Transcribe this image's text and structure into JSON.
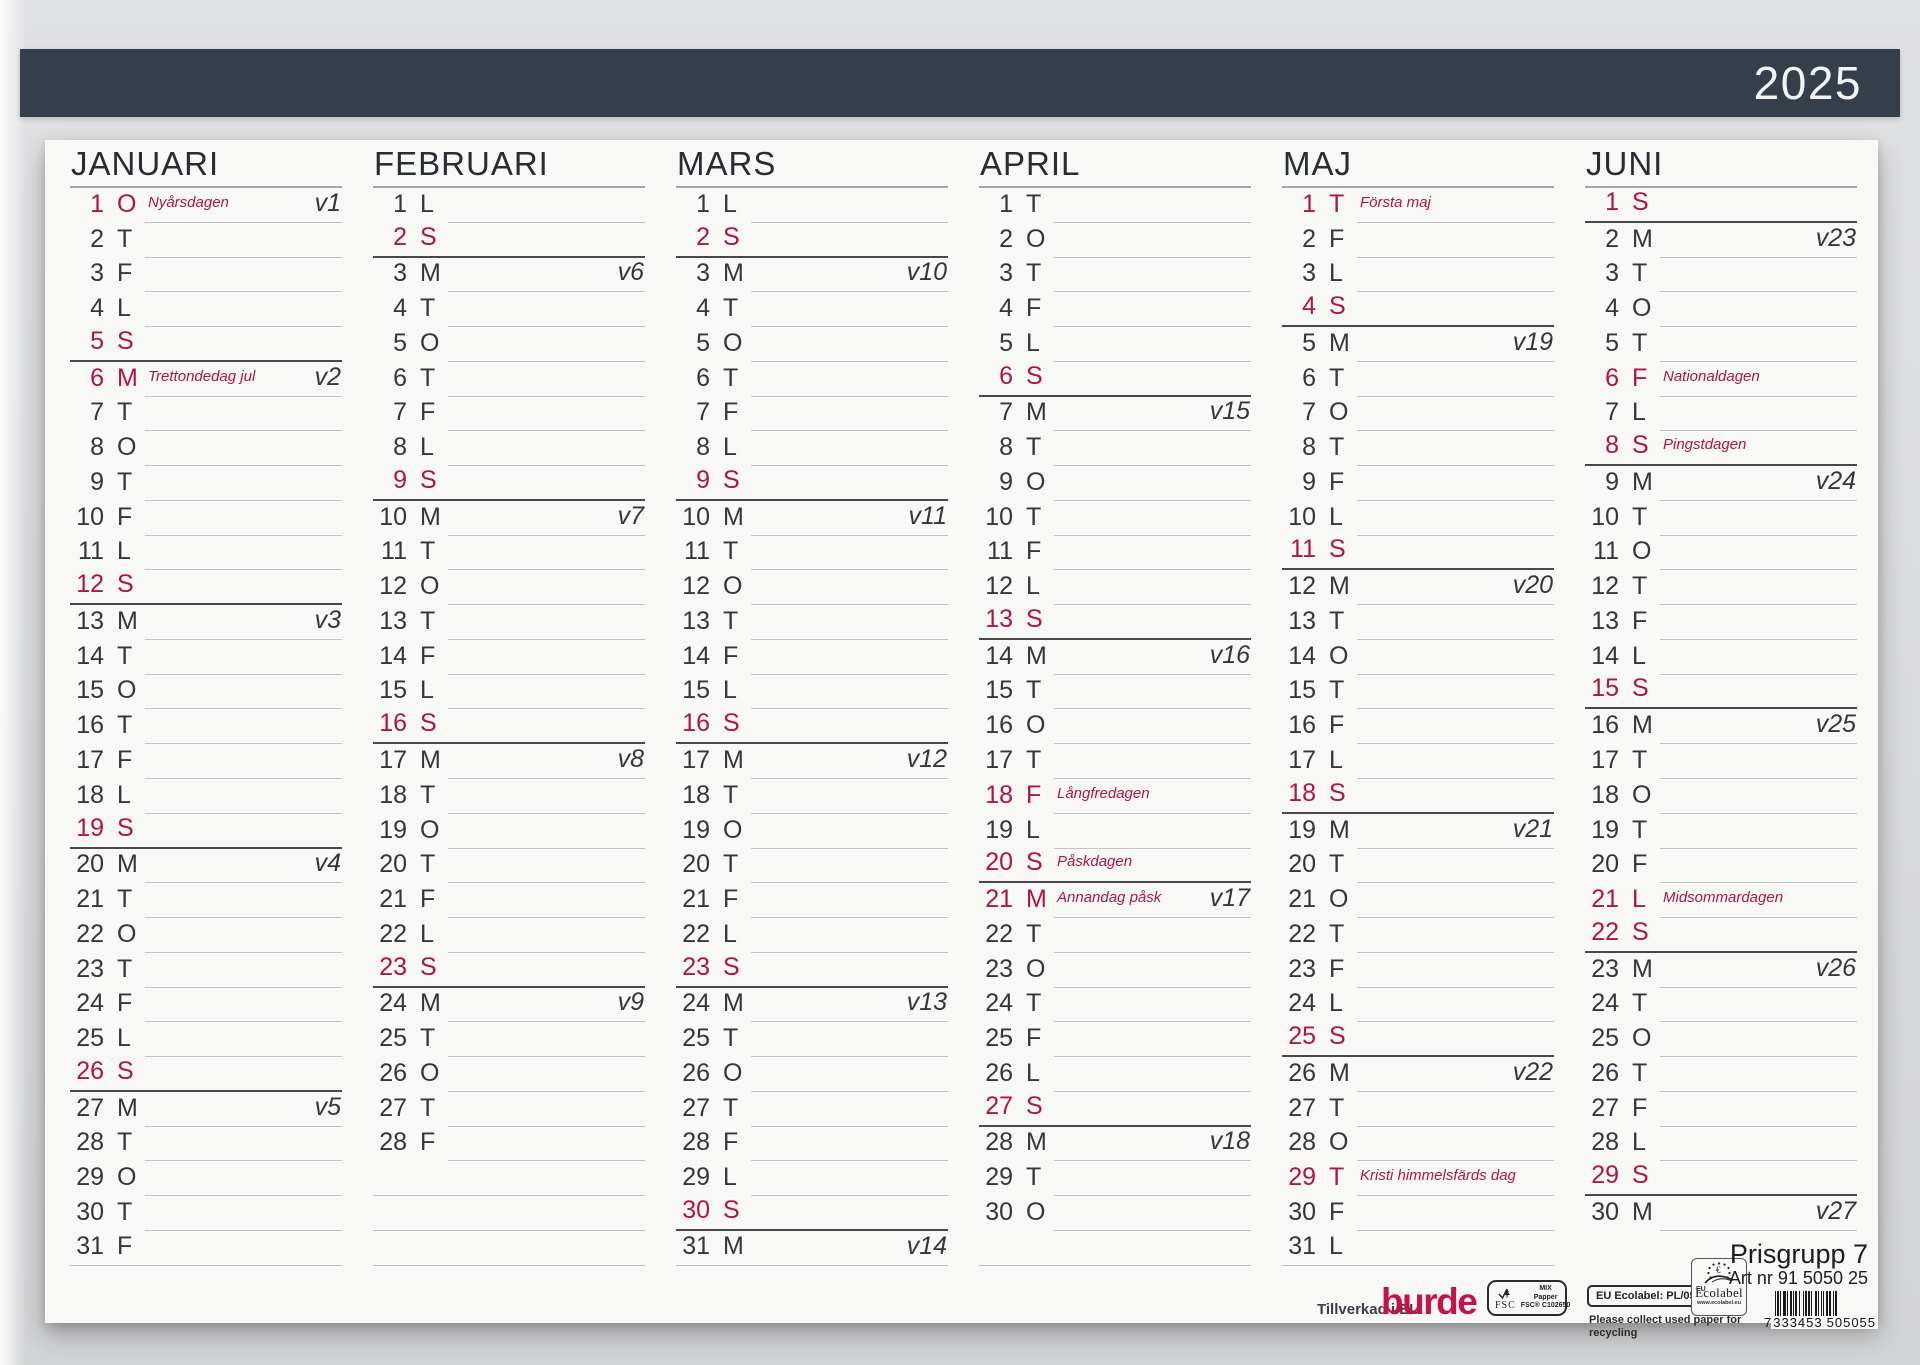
{
  "year": "2025",
  "colors": {
    "band": "#353e4b",
    "red": "#ae1543",
    "brand_red": "#c4134a",
    "paper": "#f8f8f7"
  },
  "months": [
    {
      "name": "JANUARI",
      "blanks": 0,
      "days": [
        {
          "d": 1,
          "w": "O",
          "r": true,
          "h": "Nyårsdagen",
          "v": "v1"
        },
        {
          "d": 2,
          "w": "T"
        },
        {
          "d": 3,
          "w": "F"
        },
        {
          "d": 4,
          "w": "L"
        },
        {
          "d": 5,
          "w": "S"
        },
        {
          "d": 6,
          "w": "M",
          "r": true,
          "h": "Trettondedag jul",
          "v": "v2"
        },
        {
          "d": 7,
          "w": "T"
        },
        {
          "d": 8,
          "w": "O"
        },
        {
          "d": 9,
          "w": "T"
        },
        {
          "d": 10,
          "w": "F"
        },
        {
          "d": 11,
          "w": "L"
        },
        {
          "d": 12,
          "w": "S"
        },
        {
          "d": 13,
          "w": "M",
          "v": "v3"
        },
        {
          "d": 14,
          "w": "T"
        },
        {
          "d": 15,
          "w": "O"
        },
        {
          "d": 16,
          "w": "T"
        },
        {
          "d": 17,
          "w": "F"
        },
        {
          "d": 18,
          "w": "L"
        },
        {
          "d": 19,
          "w": "S"
        },
        {
          "d": 20,
          "w": "M",
          "v": "v4"
        },
        {
          "d": 21,
          "w": "T"
        },
        {
          "d": 22,
          "w": "O"
        },
        {
          "d": 23,
          "w": "T"
        },
        {
          "d": 24,
          "w": "F"
        },
        {
          "d": 25,
          "w": "L"
        },
        {
          "d": 26,
          "w": "S"
        },
        {
          "d": 27,
          "w": "M",
          "v": "v5"
        },
        {
          "d": 28,
          "w": "T"
        },
        {
          "d": 29,
          "w": "O"
        },
        {
          "d": 30,
          "w": "T"
        },
        {
          "d": 31,
          "w": "F"
        }
      ]
    },
    {
      "name": "FEBRUARI",
      "blanks": 3,
      "days": [
        {
          "d": 1,
          "w": "L"
        },
        {
          "d": 2,
          "w": "S"
        },
        {
          "d": 3,
          "w": "M",
          "v": "v6"
        },
        {
          "d": 4,
          "w": "T"
        },
        {
          "d": 5,
          "w": "O"
        },
        {
          "d": 6,
          "w": "T"
        },
        {
          "d": 7,
          "w": "F"
        },
        {
          "d": 8,
          "w": "L"
        },
        {
          "d": 9,
          "w": "S"
        },
        {
          "d": 10,
          "w": "M",
          "v": "v7"
        },
        {
          "d": 11,
          "w": "T"
        },
        {
          "d": 12,
          "w": "O"
        },
        {
          "d": 13,
          "w": "T"
        },
        {
          "d": 14,
          "w": "F"
        },
        {
          "d": 15,
          "w": "L"
        },
        {
          "d": 16,
          "w": "S"
        },
        {
          "d": 17,
          "w": "M",
          "v": "v8"
        },
        {
          "d": 18,
          "w": "T"
        },
        {
          "d": 19,
          "w": "O"
        },
        {
          "d": 20,
          "w": "T"
        },
        {
          "d": 21,
          "w": "F"
        },
        {
          "d": 22,
          "w": "L"
        },
        {
          "d": 23,
          "w": "S"
        },
        {
          "d": 24,
          "w": "M",
          "v": "v9"
        },
        {
          "d": 25,
          "w": "T"
        },
        {
          "d": 26,
          "w": "O"
        },
        {
          "d": 27,
          "w": "T"
        },
        {
          "d": 28,
          "w": "F"
        }
      ]
    },
    {
      "name": "MARS",
      "blanks": 0,
      "days": [
        {
          "d": 1,
          "w": "L"
        },
        {
          "d": 2,
          "w": "S"
        },
        {
          "d": 3,
          "w": "M",
          "v": "v10"
        },
        {
          "d": 4,
          "w": "T"
        },
        {
          "d": 5,
          "w": "O"
        },
        {
          "d": 6,
          "w": "T"
        },
        {
          "d": 7,
          "w": "F"
        },
        {
          "d": 8,
          "w": "L"
        },
        {
          "d": 9,
          "w": "S"
        },
        {
          "d": 10,
          "w": "M",
          "v": "v11"
        },
        {
          "d": 11,
          "w": "T"
        },
        {
          "d": 12,
          "w": "O"
        },
        {
          "d": 13,
          "w": "T"
        },
        {
          "d": 14,
          "w": "F"
        },
        {
          "d": 15,
          "w": "L"
        },
        {
          "d": 16,
          "w": "S"
        },
        {
          "d": 17,
          "w": "M",
          "v": "v12"
        },
        {
          "d": 18,
          "w": "T"
        },
        {
          "d": 19,
          "w": "O"
        },
        {
          "d": 20,
          "w": "T"
        },
        {
          "d": 21,
          "w": "F"
        },
        {
          "d": 22,
          "w": "L"
        },
        {
          "d": 23,
          "w": "S"
        },
        {
          "d": 24,
          "w": "M",
          "v": "v13"
        },
        {
          "d": 25,
          "w": "T"
        },
        {
          "d": 26,
          "w": "O"
        },
        {
          "d": 27,
          "w": "T"
        },
        {
          "d": 28,
          "w": "F"
        },
        {
          "d": 29,
          "w": "L"
        },
        {
          "d": 30,
          "w": "S"
        },
        {
          "d": 31,
          "w": "M",
          "v": "v14"
        }
      ]
    },
    {
      "name": "APRIL",
      "blanks": 1,
      "days": [
        {
          "d": 1,
          "w": "T"
        },
        {
          "d": 2,
          "w": "O"
        },
        {
          "d": 3,
          "w": "T"
        },
        {
          "d": 4,
          "w": "F"
        },
        {
          "d": 5,
          "w": "L"
        },
        {
          "d": 6,
          "w": "S"
        },
        {
          "d": 7,
          "w": "M",
          "v": "v15"
        },
        {
          "d": 8,
          "w": "T"
        },
        {
          "d": 9,
          "w": "O"
        },
        {
          "d": 10,
          "w": "T"
        },
        {
          "d": 11,
          "w": "F"
        },
        {
          "d": 12,
          "w": "L"
        },
        {
          "d": 13,
          "w": "S"
        },
        {
          "d": 14,
          "w": "M",
          "v": "v16"
        },
        {
          "d": 15,
          "w": "T"
        },
        {
          "d": 16,
          "w": "O"
        },
        {
          "d": 17,
          "w": "T"
        },
        {
          "d": 18,
          "w": "F",
          "r": true,
          "h": "Långfredagen"
        },
        {
          "d": 19,
          "w": "L"
        },
        {
          "d": 20,
          "w": "S",
          "h": "Påskdagen"
        },
        {
          "d": 21,
          "w": "M",
          "r": true,
          "h": "Annandag påsk",
          "v": "v17"
        },
        {
          "d": 22,
          "w": "T"
        },
        {
          "d": 23,
          "w": "O"
        },
        {
          "d": 24,
          "w": "T"
        },
        {
          "d": 25,
          "w": "F"
        },
        {
          "d": 26,
          "w": "L"
        },
        {
          "d": 27,
          "w": "S"
        },
        {
          "d": 28,
          "w": "M",
          "v": "v18"
        },
        {
          "d": 29,
          "w": "T"
        },
        {
          "d": 30,
          "w": "O"
        }
      ]
    },
    {
      "name": "MAJ",
      "blanks": 0,
      "days": [
        {
          "d": 1,
          "w": "T",
          "r": true,
          "h": "Första maj"
        },
        {
          "d": 2,
          "w": "F"
        },
        {
          "d": 3,
          "w": "L"
        },
        {
          "d": 4,
          "w": "S"
        },
        {
          "d": 5,
          "w": "M",
          "v": "v19"
        },
        {
          "d": 6,
          "w": "T"
        },
        {
          "d": 7,
          "w": "O"
        },
        {
          "d": 8,
          "w": "T"
        },
        {
          "d": 9,
          "w": "F"
        },
        {
          "d": 10,
          "w": "L"
        },
        {
          "d": 11,
          "w": "S"
        },
        {
          "d": 12,
          "w": "M",
          "v": "v20"
        },
        {
          "d": 13,
          "w": "T"
        },
        {
          "d": 14,
          "w": "O"
        },
        {
          "d": 15,
          "w": "T"
        },
        {
          "d": 16,
          "w": "F"
        },
        {
          "d": 17,
          "w": "L"
        },
        {
          "d": 18,
          "w": "S"
        },
        {
          "d": 19,
          "w": "M",
          "v": "v21"
        },
        {
          "d": 20,
          "w": "T"
        },
        {
          "d": 21,
          "w": "O"
        },
        {
          "d": 22,
          "w": "T"
        },
        {
          "d": 23,
          "w": "F"
        },
        {
          "d": 24,
          "w": "L"
        },
        {
          "d": 25,
          "w": "S"
        },
        {
          "d": 26,
          "w": "M",
          "v": "v22"
        },
        {
          "d": 27,
          "w": "T"
        },
        {
          "d": 28,
          "w": "O"
        },
        {
          "d": 29,
          "w": "T",
          "r": true,
          "h": "Kristi himmelsfärds dag"
        },
        {
          "d": 30,
          "w": "F"
        },
        {
          "d": 31,
          "w": "L"
        }
      ]
    },
    {
      "name": "JUNI",
      "blanks": 0,
      "days": [
        {
          "d": 1,
          "w": "S"
        },
        {
          "d": 2,
          "w": "M",
          "v": "v23"
        },
        {
          "d": 3,
          "w": "T"
        },
        {
          "d": 4,
          "w": "O"
        },
        {
          "d": 5,
          "w": "T"
        },
        {
          "d": 6,
          "w": "F",
          "r": true,
          "h": "Nationaldagen"
        },
        {
          "d": 7,
          "w": "L"
        },
        {
          "d": 8,
          "w": "S",
          "h": "Pingstdagen"
        },
        {
          "d": 9,
          "w": "M",
          "v": "v24"
        },
        {
          "d": 10,
          "w": "T"
        },
        {
          "d": 11,
          "w": "O"
        },
        {
          "d": 12,
          "w": "T"
        },
        {
          "d": 13,
          "w": "F"
        },
        {
          "d": 14,
          "w": "L"
        },
        {
          "d": 15,
          "w": "S"
        },
        {
          "d": 16,
          "w": "M",
          "v": "v25"
        },
        {
          "d": 17,
          "w": "T"
        },
        {
          "d": 18,
          "w": "O"
        },
        {
          "d": 19,
          "w": "T"
        },
        {
          "d": 20,
          "w": "F"
        },
        {
          "d": 21,
          "w": "L",
          "r": true,
          "h": "Midsommardagen"
        },
        {
          "d": 22,
          "w": "S"
        },
        {
          "d": 23,
          "w": "M",
          "v": "v26"
        },
        {
          "d": 24,
          "w": "T"
        },
        {
          "d": 25,
          "w": "O"
        },
        {
          "d": 26,
          "w": "T"
        },
        {
          "d": 27,
          "w": "F"
        },
        {
          "d": 28,
          "w": "L"
        },
        {
          "d": 29,
          "w": "S"
        },
        {
          "d": 30,
          "w": "M",
          "v": "v27"
        }
      ]
    }
  ],
  "footer": {
    "made_in": "Tillverkad i EU",
    "brand": "burde",
    "fsc": {
      "label": "FSC",
      "mix": "MIX",
      "papper": "Papper",
      "cert": "FSC® C102650"
    },
    "eu_ecolabel_box": "EU Ecolabel: PL/053/005",
    "recycle_note": "Please collect used paper for recycling",
    "ecolabel_logo": {
      "eu": "EU",
      "name": "Ecolabel",
      "url": "www.ecolabel.eu"
    },
    "price_group": "Prisgrupp 7",
    "art_nr": "Art nr 91 5050 25",
    "barcode": {
      "lead": "7",
      "group1": "333453",
      "group2": "505055"
    }
  }
}
